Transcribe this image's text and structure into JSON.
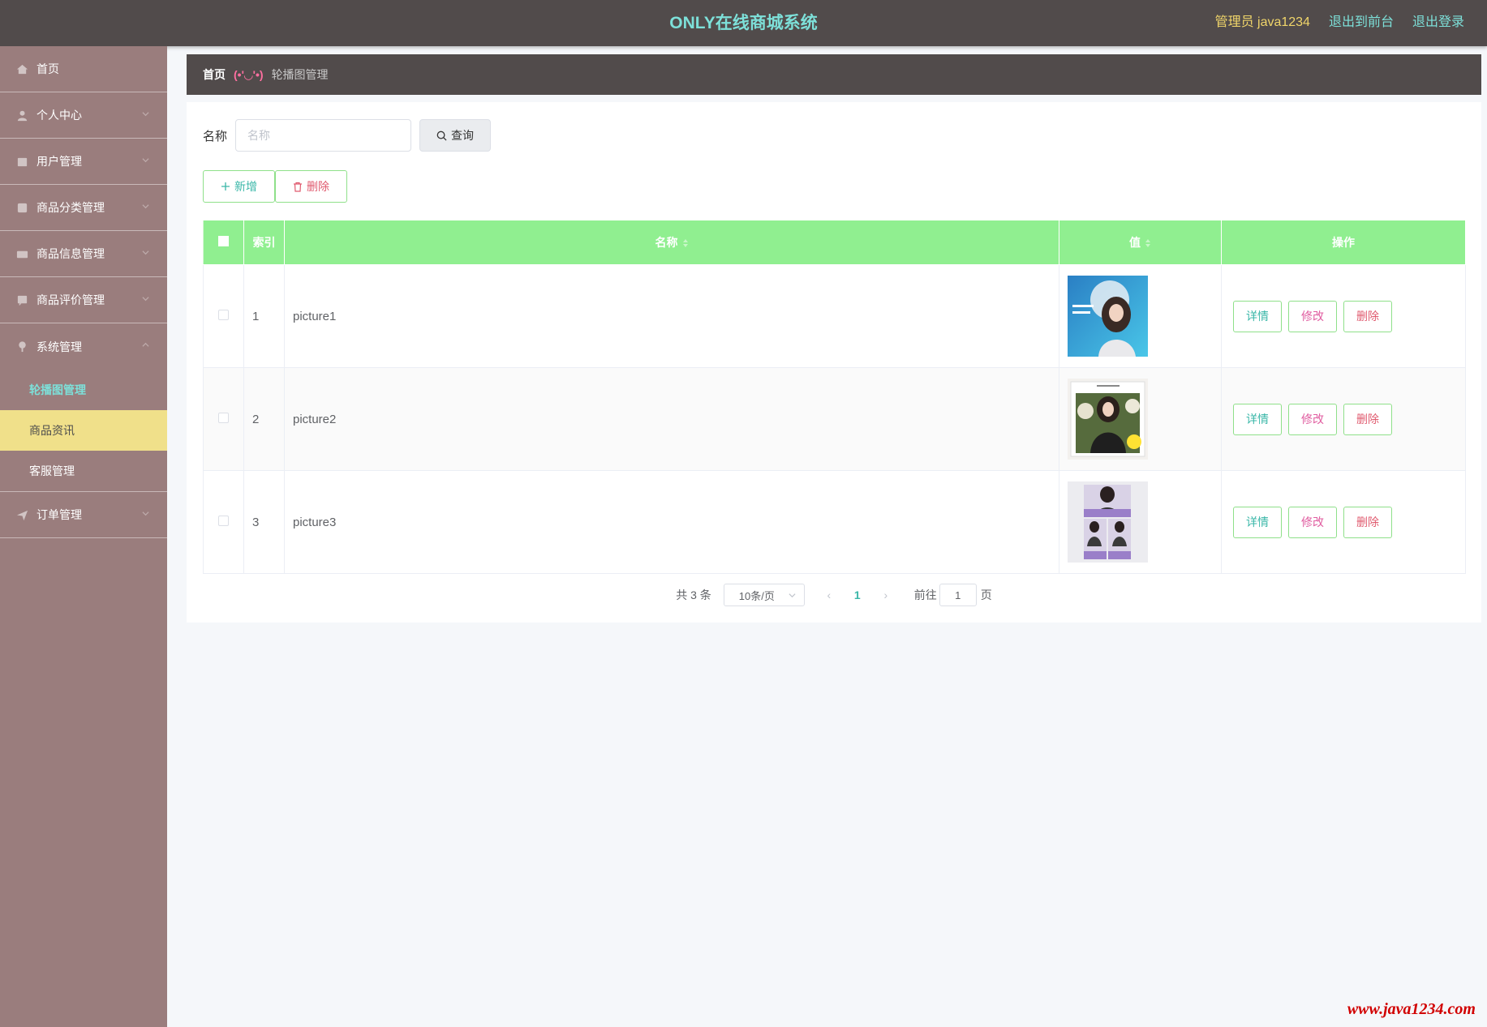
{
  "header": {
    "title": "ONLY在线商城系统",
    "admin": "管理员 java1234",
    "back_front": "退出到前台",
    "logout": "退出登录"
  },
  "sidebar": {
    "items": [
      {
        "label": "首页",
        "icon": "home-icon"
      },
      {
        "label": "个人中心",
        "icon": "user-icon"
      },
      {
        "label": "用户管理",
        "icon": "users-icon"
      },
      {
        "label": "商品分类管理",
        "icon": "category-icon"
      },
      {
        "label": "商品信息管理",
        "icon": "goods-icon"
      },
      {
        "label": "商品评价管理",
        "icon": "comment-icon"
      },
      {
        "label": "系统管理",
        "icon": "system-icon"
      },
      {
        "label": "订单管理",
        "icon": "order-icon"
      }
    ],
    "sub_items": [
      "轮播图管理",
      "商品资讯",
      "客服管理"
    ]
  },
  "breadcrumb": {
    "home": "首页",
    "separator": "(•'◡'•)",
    "current": "轮播图管理"
  },
  "search": {
    "label": "名称",
    "placeholder": "名称",
    "button": "查询"
  },
  "actions": {
    "add": "新增",
    "delete": "删除"
  },
  "table": {
    "headers": {
      "index": "索引",
      "name": "名称",
      "value": "值",
      "ops": "操作"
    },
    "rows": [
      {
        "index": "1",
        "name": "picture1"
      },
      {
        "index": "2",
        "name": "picture2"
      },
      {
        "index": "3",
        "name": "picture3"
      }
    ],
    "ops": {
      "detail": "详情",
      "edit": "修改",
      "remove": "删除"
    }
  },
  "pagination": {
    "total": "共 3 条",
    "page_size": "10条/页",
    "current_page": "1",
    "goto_label": "前往",
    "goto_value": "1",
    "page_suffix": "页"
  },
  "watermark": "www.java1234.com",
  "colors": {
    "header_bg": "#514b4b",
    "title": "#7de0d9",
    "admin": "#f0d56a",
    "sidebar_bg": "#9a7d7d",
    "table_header": "#90ef90",
    "active_sub": "#f0e08a"
  }
}
